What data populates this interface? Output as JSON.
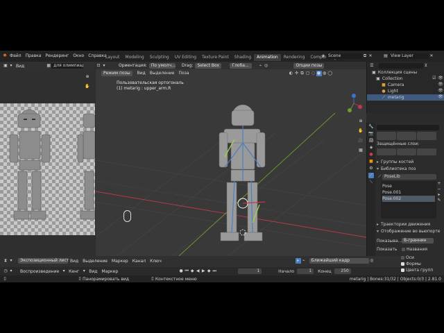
{
  "topbar": {
    "menu": [
      "Файл",
      "Правка",
      "Рендеринг",
      "Окно",
      "Справка"
    ],
    "tabs": [
      "Layout",
      "Modeling",
      "Sculpting",
      "UV Editing",
      "Texture Paint",
      "Shading",
      "Animation",
      "Rendering",
      "Compositing",
      "Sc"
    ],
    "active_tab": "Animation",
    "scene": "Scene",
    "view_layer": "View Layer"
  },
  "image_editor": {
    "view_label": "Вид",
    "image_name": "для олимпиады.j"
  },
  "viewport": {
    "mode": "Режим позы",
    "menu": [
      "Вид",
      "Выделение",
      "Поза"
    ],
    "orientation_label": "Ориентация:",
    "orientation_value": "По умолч...",
    "drag_label": "Drag:",
    "drag_value": "Select Box",
    "pivot_value": "Глоба...",
    "overlay_label": "Опции позы",
    "info_line1": "Пользовательская ортогональ",
    "info_line2": "(1) metarig : upper_arm.R"
  },
  "outliner": {
    "title": "Коллекция сцены",
    "items": [
      {
        "label": "Collection"
      },
      {
        "label": "Camera"
      },
      {
        "label": "Light"
      },
      {
        "label": "metarig"
      }
    ]
  },
  "properties": {
    "protected_layers": "Защищённые слои:",
    "sections": [
      "Группы костей",
      "Библиотека поз"
    ],
    "poselib_name": "PoseLib",
    "poses": [
      "Pose",
      "Pose.001",
      "Pose.002"
    ],
    "motion_paths": "Траектории движения",
    "viewport_display": "Отображение во вьюпорте",
    "show_as_label": "Показыва...",
    "show_as_value": "В-граннин",
    "show_label": "Показать",
    "checks": [
      {
        "label": "Названия",
        "checked": false
      },
      {
        "label": "Оси",
        "checked": false
      },
      {
        "label": "Формы",
        "checked": true
      },
      {
        "label": "Цвета групп",
        "checked": true
      }
    ]
  },
  "timeline": {
    "editor_type": "Экспозиционный лист",
    "menu": [
      "Вид",
      "Выделение",
      "Маркер",
      "Канал",
      "Ключ"
    ],
    "keying_label": "Ближайший кадр",
    "playback": "Воспроизведение",
    "keying": "Кенг",
    "view": "Вид",
    "marker": "Маркер",
    "current_frame": "1",
    "start_label": "Начало",
    "start": "1",
    "end_label": "Конец",
    "end": "250"
  },
  "statusbar": {
    "left_hint": "Панорамировать вид",
    "mid_hint": "Контекстное меню",
    "right_info": "metarig | Bones:31/32 | Objects:0/3 | 2.81.0"
  },
  "colors": {
    "accent": "#4a7fc1",
    "active_tab_bg": "#3d3d3d",
    "viewport_bg": "#393939",
    "x_axis": "#c0394b",
    "y_axis": "#6b9d2b"
  }
}
